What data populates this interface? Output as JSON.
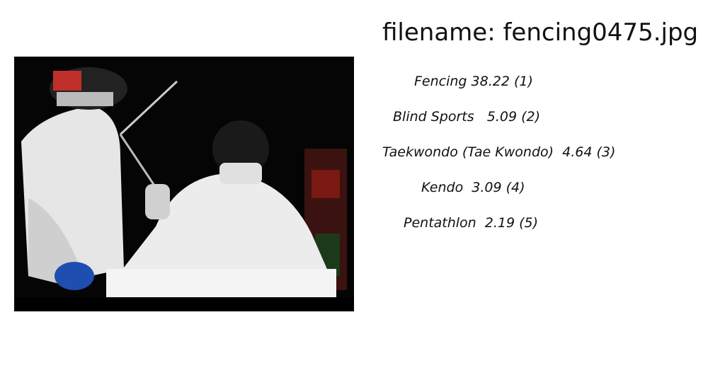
{
  "filename_text": "filename: fencing0475.jpg",
  "predictions": [
    {
      "text": "Fencing 38.22 (1)"
    },
    {
      "text": "Blind Sports   5.09 (2)"
    },
    {
      "text": "Taekwondo (Tae Kwondo)  4.64 (3)"
    },
    {
      "text": "Kendo  3.09 (4)"
    },
    {
      "text": "Pentathlon  2.19 (5)"
    }
  ]
}
